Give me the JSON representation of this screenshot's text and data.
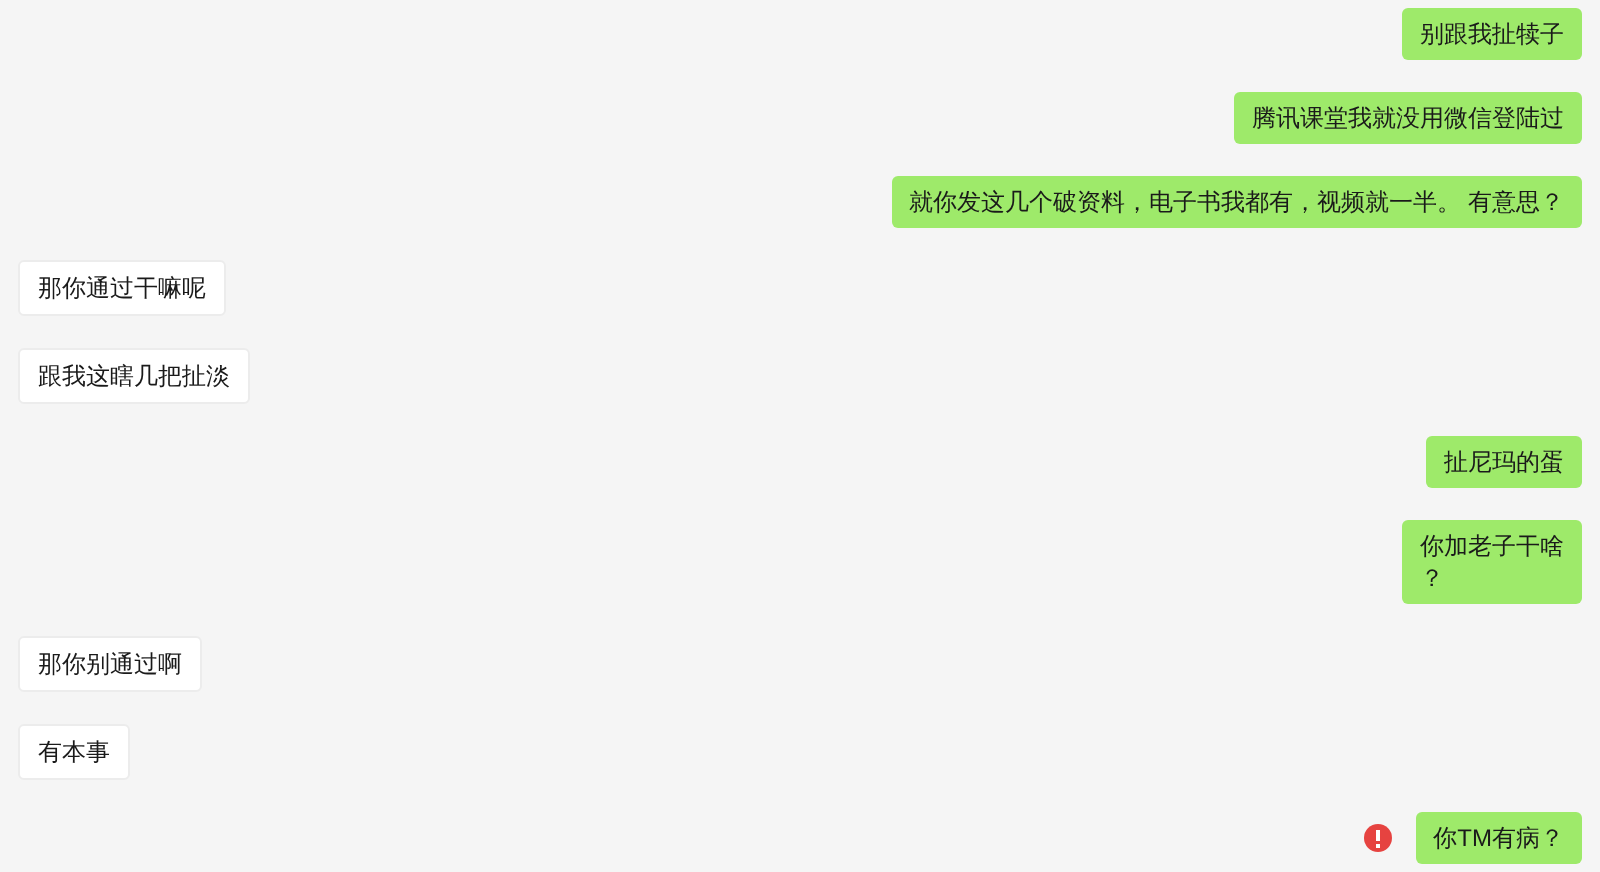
{
  "messages": [
    {
      "kind": "sent",
      "lines": [
        "别跟我扯犊子"
      ],
      "failed": false
    },
    {
      "kind": "sent",
      "lines": [
        "腾讯课堂我就没用微信登陆过"
      ],
      "failed": false
    },
    {
      "kind": "sent",
      "lines": [
        "就你发这几个破资料，电子书我都有，视频就一半。 有意思？"
      ],
      "failed": false
    },
    {
      "kind": "received",
      "lines": [
        "那你通过干嘛呢"
      ]
    },
    {
      "kind": "received",
      "lines": [
        "跟我这瞎几把扯淡"
      ]
    },
    {
      "kind": "sent",
      "lines": [
        "扯尼玛的蛋"
      ],
      "failed": false
    },
    {
      "kind": "sent",
      "lines": [
        "你加老子干啥",
        "？"
      ],
      "failed": false
    },
    {
      "kind": "received",
      "lines": [
        "那你别通过啊"
      ]
    },
    {
      "kind": "received",
      "lines": [
        "有本事"
      ]
    },
    {
      "kind": "sent",
      "lines": [
        "你TM有病？"
      ],
      "failed": true
    }
  ]
}
